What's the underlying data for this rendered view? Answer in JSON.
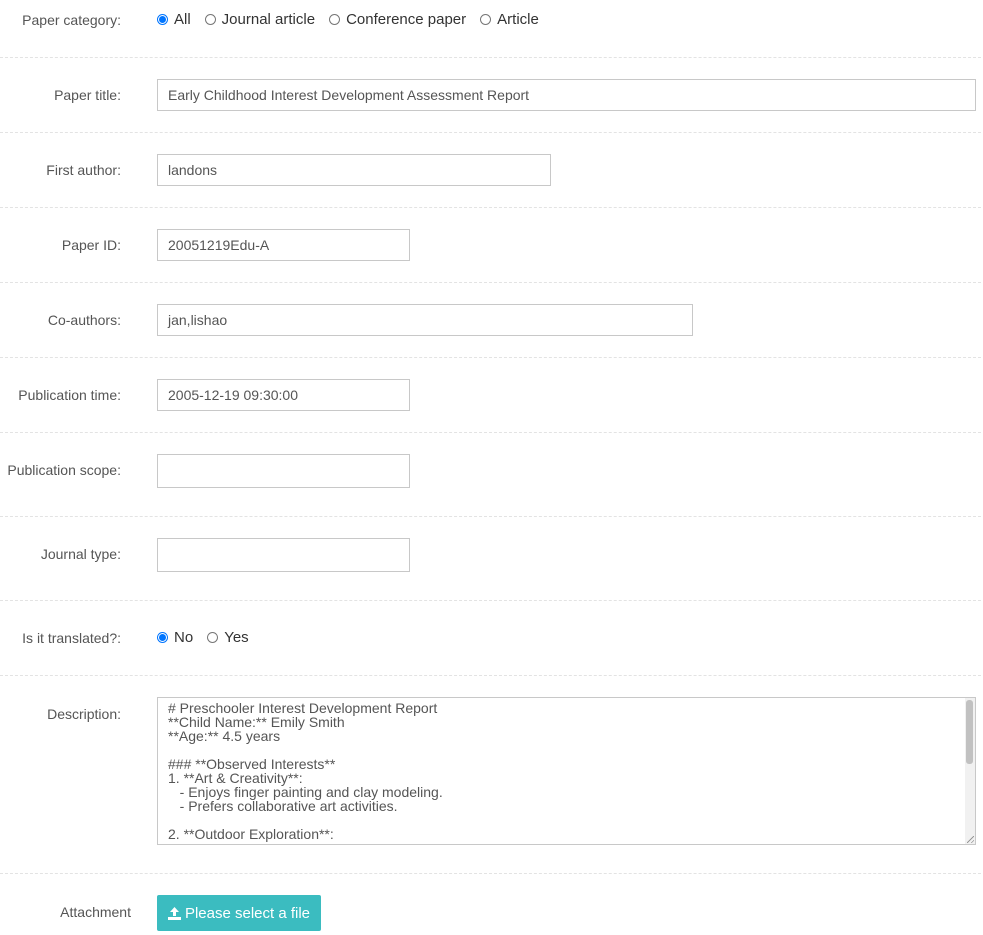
{
  "paper_category": {
    "label": "Paper category",
    "options": [
      {
        "label": "All",
        "checked": true
      },
      {
        "label": "Journal article",
        "checked": false
      },
      {
        "label": "Conference paper",
        "checked": false
      },
      {
        "label": "Article",
        "checked": false
      }
    ]
  },
  "paper_title": {
    "label": "Paper title",
    "value": "Early Childhood Interest Development Assessment Report"
  },
  "first_author": {
    "label": "First author",
    "value": "landons"
  },
  "paper_id": {
    "label": "Paper ID",
    "value": "20051219Edu-A"
  },
  "co_authors": {
    "label": "Co-authors",
    "value": "jan,lishao"
  },
  "publication_time": {
    "label": "Publication time",
    "value": "2005-12-19 09:30:00"
  },
  "publication_scope": {
    "label": "Publication scope",
    "value": ""
  },
  "journal_type": {
    "label": "Journal type",
    "value": ""
  },
  "translated": {
    "label": "Is it translated?",
    "options": [
      {
        "label": "No",
        "checked": true
      },
      {
        "label": "Yes",
        "checked": false
      }
    ]
  },
  "description": {
    "label": "Description",
    "value": "# Preschooler Interest Development Report\n**Child Name:** Emily Smith\n**Age:** 4.5 years\n\n### **Observed Interests**\n1. **Art & Creativity**:\n   - Enjoys finger painting and clay modeling.\n   - Prefers collaborative art activities.\n\n2. **Outdoor Exploration**:"
  },
  "attachment": {
    "label": "Attachment",
    "button_label": "Please select a file"
  },
  "colors": {
    "accent": "#3bbcc0",
    "radio_checked": "#0075ff"
  }
}
